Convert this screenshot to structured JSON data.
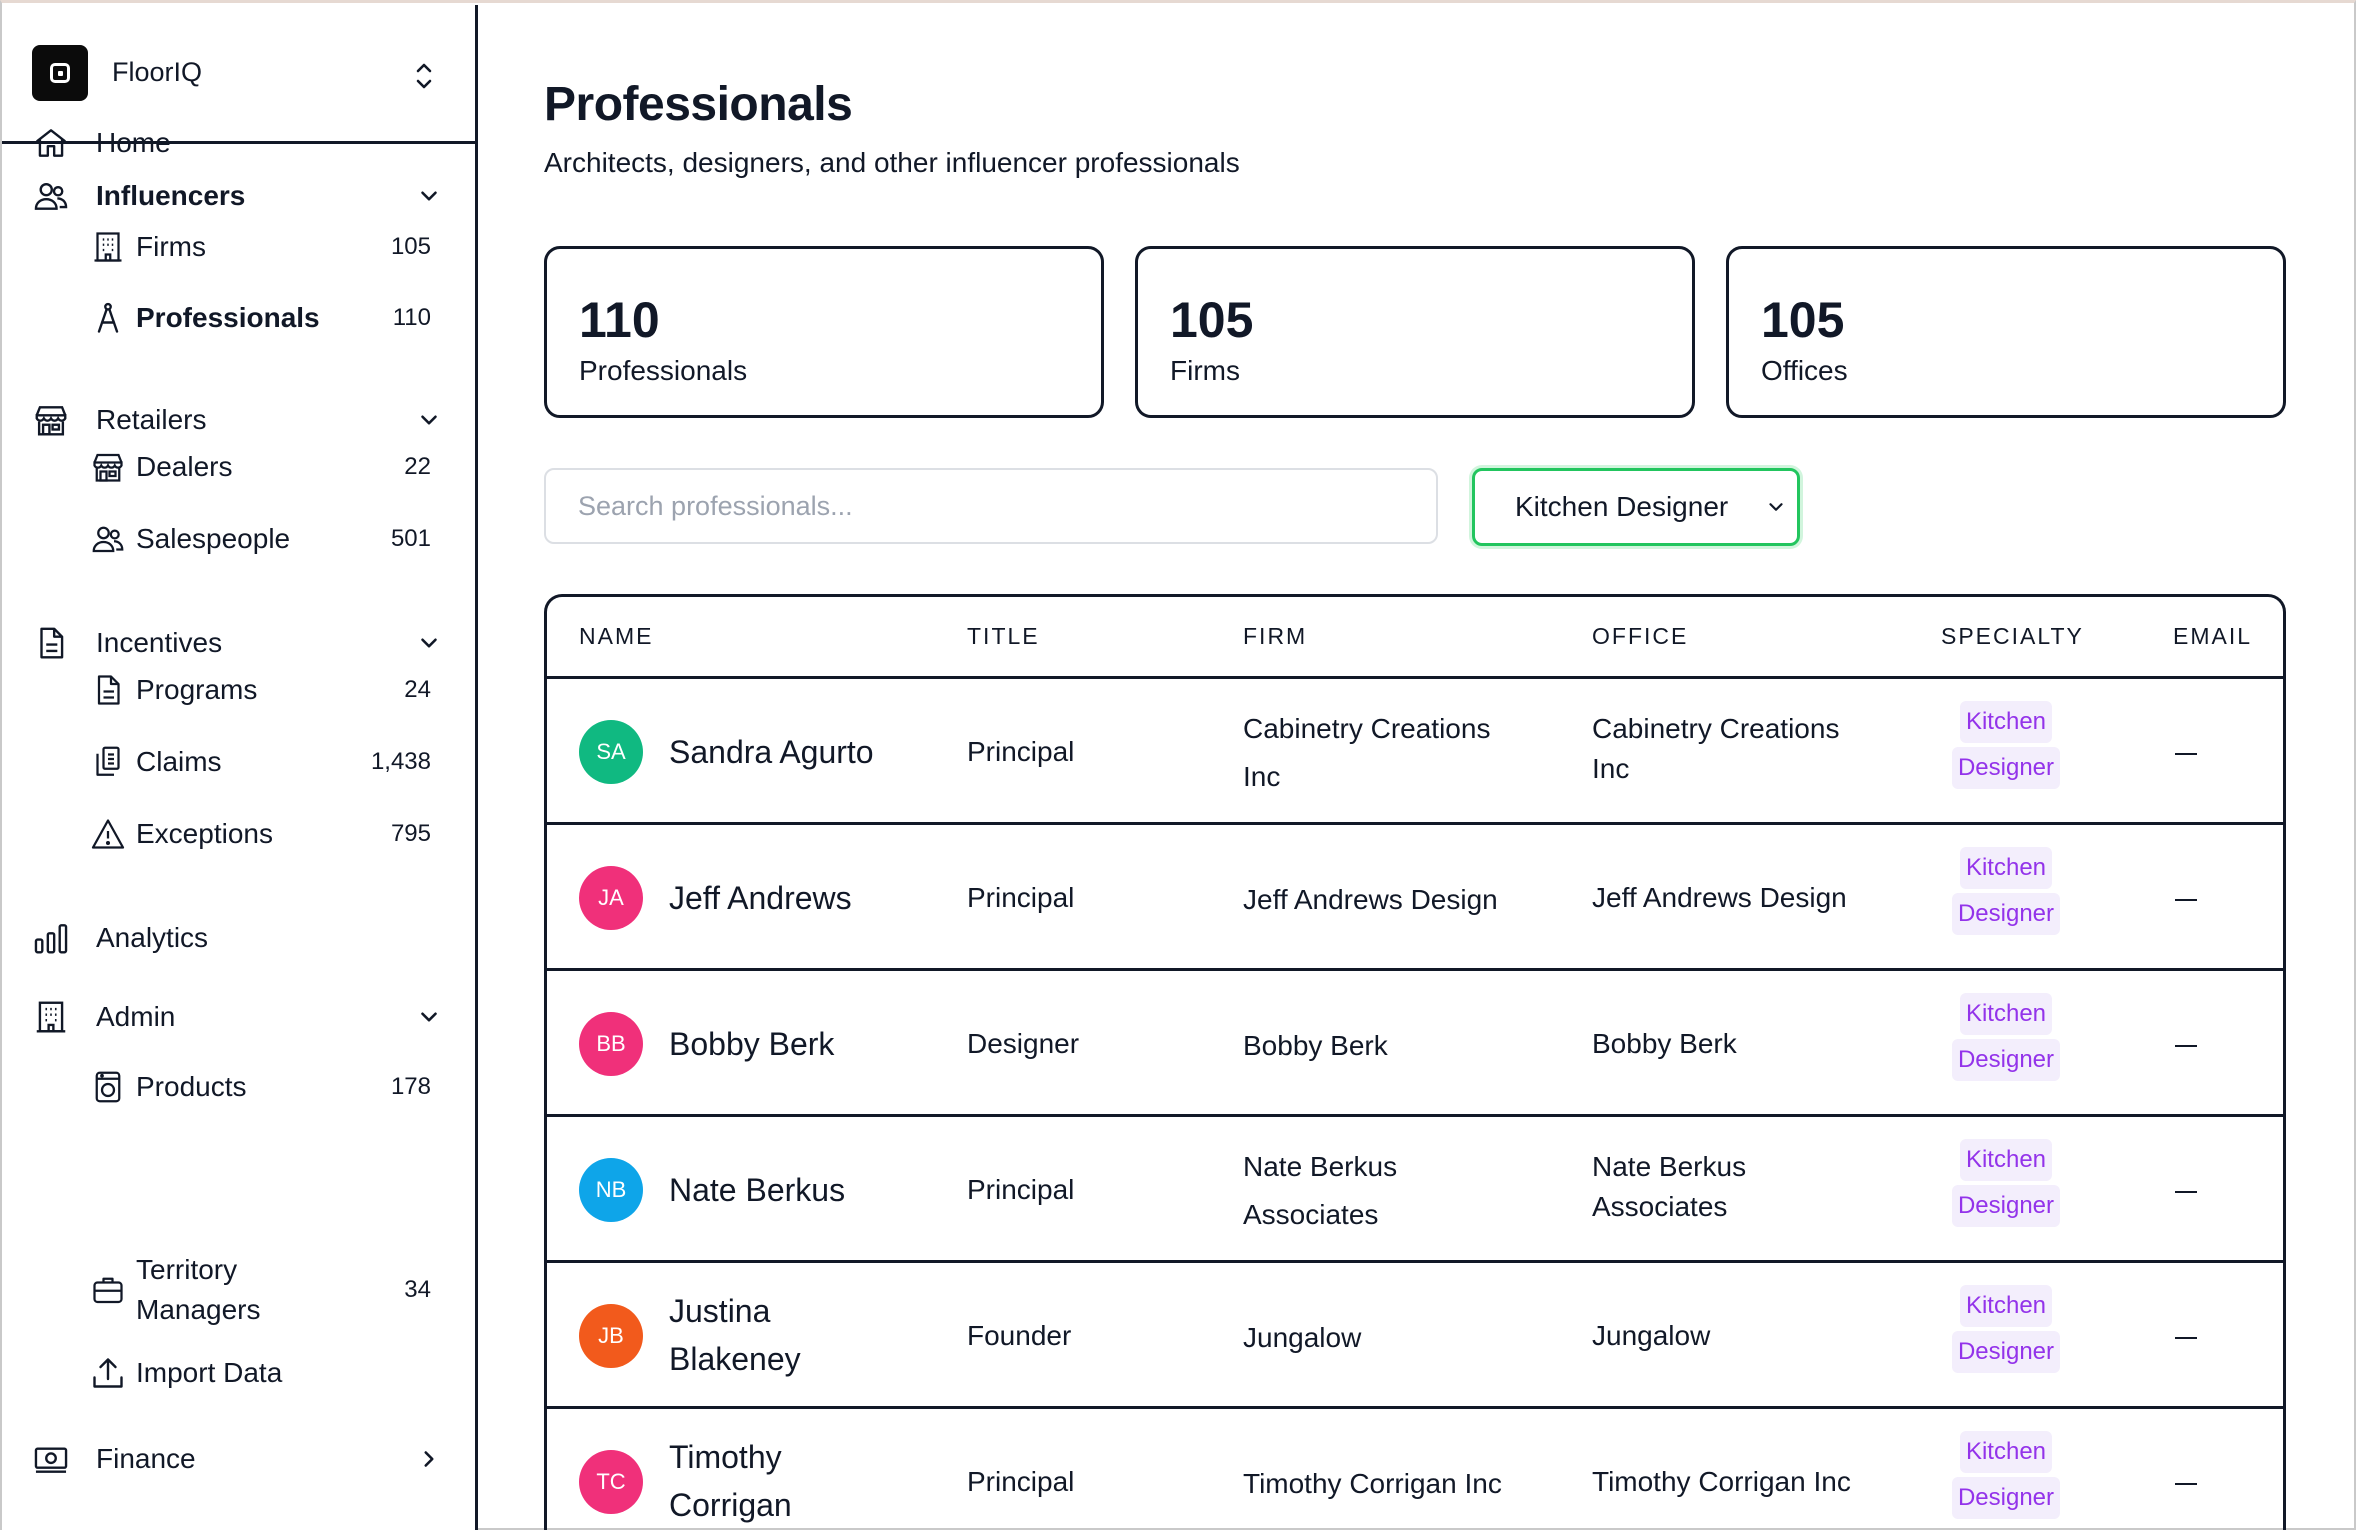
{
  "app": {
    "name": "FloorIQ"
  },
  "sidebar": {
    "home": "Home",
    "influencers": {
      "label": "Influencers",
      "firms": {
        "label": "Firms",
        "count": "105"
      },
      "professionals": {
        "label": "Professionals",
        "count": "110"
      }
    },
    "retailers": {
      "label": "Retailers",
      "dealers": {
        "label": "Dealers",
        "count": "22"
      },
      "salespeople": {
        "label": "Salespeople",
        "count": "501"
      }
    },
    "incentives": {
      "label": "Incentives",
      "programs": {
        "label": "Programs",
        "count": "24"
      },
      "claims": {
        "label": "Claims",
        "count": "1,438"
      },
      "exceptions": {
        "label": "Exceptions",
        "count": "795"
      }
    },
    "analytics": "Analytics",
    "admin": {
      "label": "Admin",
      "products": {
        "label": "Products",
        "count": "178"
      },
      "territory": {
        "label_line1": "Territory",
        "label_line2": "Managers",
        "count": "34"
      },
      "import": {
        "label": "Import Data"
      }
    },
    "finance": "Finance"
  },
  "header": {
    "title": "Professionals",
    "subtitle": "Architects, designers, and other influencer professionals"
  },
  "stats": [
    {
      "value": "110",
      "label": "Professionals"
    },
    {
      "value": "105",
      "label": "Firms"
    },
    {
      "value": "105",
      "label": "Offices"
    }
  ],
  "filters": {
    "search_placeholder": "Search professionals...",
    "specialty_selected": "Kitchen Designer"
  },
  "table": {
    "headers": {
      "name": "NAME",
      "title": "TITLE",
      "firm": "FIRM",
      "office": "OFFICE",
      "specialty": "SPECIALTY",
      "email": "EMAIL"
    },
    "rows": [
      {
        "initials": "SA",
        "avatar_color": "#10b981",
        "name_l1": "Sandra Agurto",
        "name_l2": "",
        "title": "Principal",
        "firm_l1": "Cabinetry Creations",
        "firm_l2": "Inc",
        "office_l1": "Cabinetry Creations",
        "office_l2": "Inc",
        "spec_l1": "Kitchen",
        "spec_l2": "Designer"
      },
      {
        "initials": "JA",
        "avatar_color": "#f0307a",
        "name_l1": "Jeff Andrews",
        "name_l2": "",
        "title": "Principal",
        "firm_l1": "Jeff Andrews Design",
        "firm_l2": "",
        "office_l1": "Jeff Andrews Design",
        "office_l2": "",
        "spec_l1": "Kitchen",
        "spec_l2": "Designer"
      },
      {
        "initials": "BB",
        "avatar_color": "#f0307a",
        "name_l1": "Bobby Berk",
        "name_l2": "",
        "title": "Designer",
        "firm_l1": "Bobby Berk",
        "firm_l2": "",
        "office_l1": "Bobby Berk",
        "office_l2": "",
        "spec_l1": "Kitchen",
        "spec_l2": "Designer"
      },
      {
        "initials": "NB",
        "avatar_color": "#0ea5e9",
        "name_l1": "Nate Berkus",
        "name_l2": "",
        "title": "Principal",
        "firm_l1": "Nate Berkus",
        "firm_l2": "Associates",
        "office_l1": "Nate Berkus",
        "office_l2": "Associates",
        "spec_l1": "Kitchen",
        "spec_l2": "Designer"
      },
      {
        "initials": "JB",
        "avatar_color": "#f25a1c",
        "name_l1": "Justina",
        "name_l2": "Blakeney",
        "title": "Founder",
        "firm_l1": "Jungalow",
        "firm_l2": "",
        "office_l1": "Jungalow",
        "office_l2": "",
        "spec_l1": "Kitchen",
        "spec_l2": "Designer"
      },
      {
        "initials": "TC",
        "avatar_color": "#f0307a",
        "name_l1": "Timothy",
        "name_l2": "Corrigan",
        "title": "Principal",
        "firm_l1": "Timothy Corrigan Inc",
        "firm_l2": "",
        "office_l1": "Timothy Corrigan Inc",
        "office_l2": "",
        "spec_l1": "Kitchen",
        "spec_l2": "Designer"
      }
    ]
  },
  "icons": {
    "brand": "floor-logo-icon",
    "switch": "chevron-up-down-icon",
    "home": "home-icon",
    "influencers": "users-icon",
    "firms": "building-icon",
    "professionals": "compass-icon",
    "retailers": "store-icon",
    "dealers": "store-icon",
    "salespeople": "users-icon",
    "incentives": "document-icon",
    "programs": "document-icon",
    "claims": "clipboard-icon",
    "exceptions": "warning-icon",
    "analytics": "bar-chart-icon",
    "admin": "building-icon",
    "products": "washer-icon",
    "territory": "briefcase-icon",
    "import": "upload-icon",
    "finance": "banknote-icon"
  },
  "colors": {
    "accent_green": "#22c55e",
    "badge_text": "#9333ea",
    "badge_bg": "#f3eefc",
    "border": "#111827"
  }
}
